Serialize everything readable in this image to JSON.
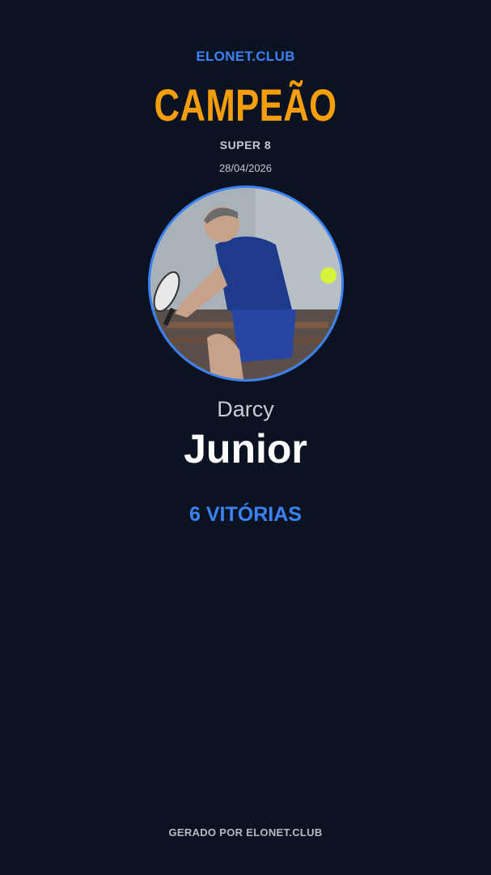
{
  "brand": "ELONET.CLUB",
  "title": "CAMPEÃO",
  "event": "SUPER 8",
  "date": "28/04/2026",
  "player": {
    "first_name": "Darcy",
    "last_name": "Junior"
  },
  "wins": "6 VITÓRIAS",
  "footer": "GERADO POR ELONET.CLUB",
  "colors": {
    "background": "#0b1221",
    "accent_blue": "#3b82f6",
    "accent_orange": "#f59e0b"
  },
  "icons": {
    "photo": "player-photo"
  }
}
